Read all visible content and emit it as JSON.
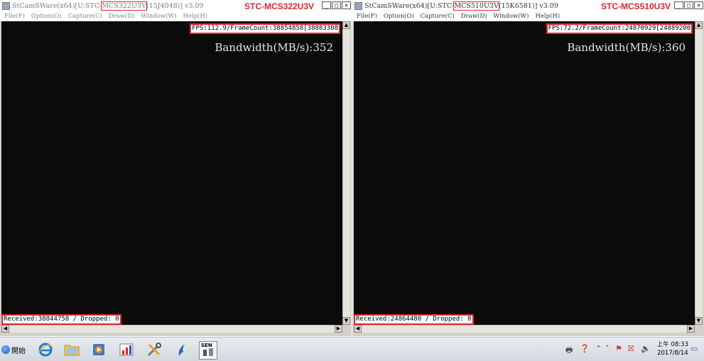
{
  "windows": [
    {
      "title_prefix": "StCamSWare(x64)[U:STC-",
      "title_model": "MCS322U3V",
      "title_suffix": "(15J4048)] v3.09",
      "model_label": "STC-MCS322U3V",
      "menu": [
        "File(F)",
        "Option(O)",
        "Capture(C)",
        "Draw(D)",
        "Window(W)",
        "Help(H)"
      ],
      "fps_text": "FPS:112.9/FrameCount:38854858[38883308",
      "bandwidth_text": "Bandwidth(MB/s):352",
      "received_text": "Received:38844758 / Dropped: 0"
    },
    {
      "title_prefix": "StCamSWare(x64)[U:STC-",
      "title_model": "MCS510U3V",
      "title_suffix": "(15K6581)] v3.09",
      "model_label": "STC-MCS510U3V",
      "menu": [
        "File(F)",
        "Option(O)",
        "Capture(C)",
        "Draw(D)",
        "Window(W)",
        "Help(H)"
      ],
      "fps_text": "FPS:72.2/FrameCount:24870929[24889200",
      "bandwidth_text": "Bandwidth(MB/s):360",
      "received_text": "Received:24864480 / Dropped: 0"
    }
  ],
  "window_buttons": {
    "minimize": "_",
    "maximize": "□",
    "close": "×"
  },
  "scroll_arrows": {
    "up": "▲",
    "down": "▼",
    "left": "◀",
    "right": "▶"
  },
  "taskbar": {
    "start_label": "開始",
    "clock_time": "上午 08:33",
    "clock_date": "2017/8/14",
    "pinned_icons": [
      "ie-icon",
      "folder-icon",
      "media-player-icon",
      "chart-app-icon",
      "tools-icon",
      "dolphin-icon",
      "sen-app-icon"
    ],
    "sen_label": "SEN"
  },
  "colors": {
    "highlight": "#e0262e",
    "viewer_bg": "#0b0b0b"
  }
}
